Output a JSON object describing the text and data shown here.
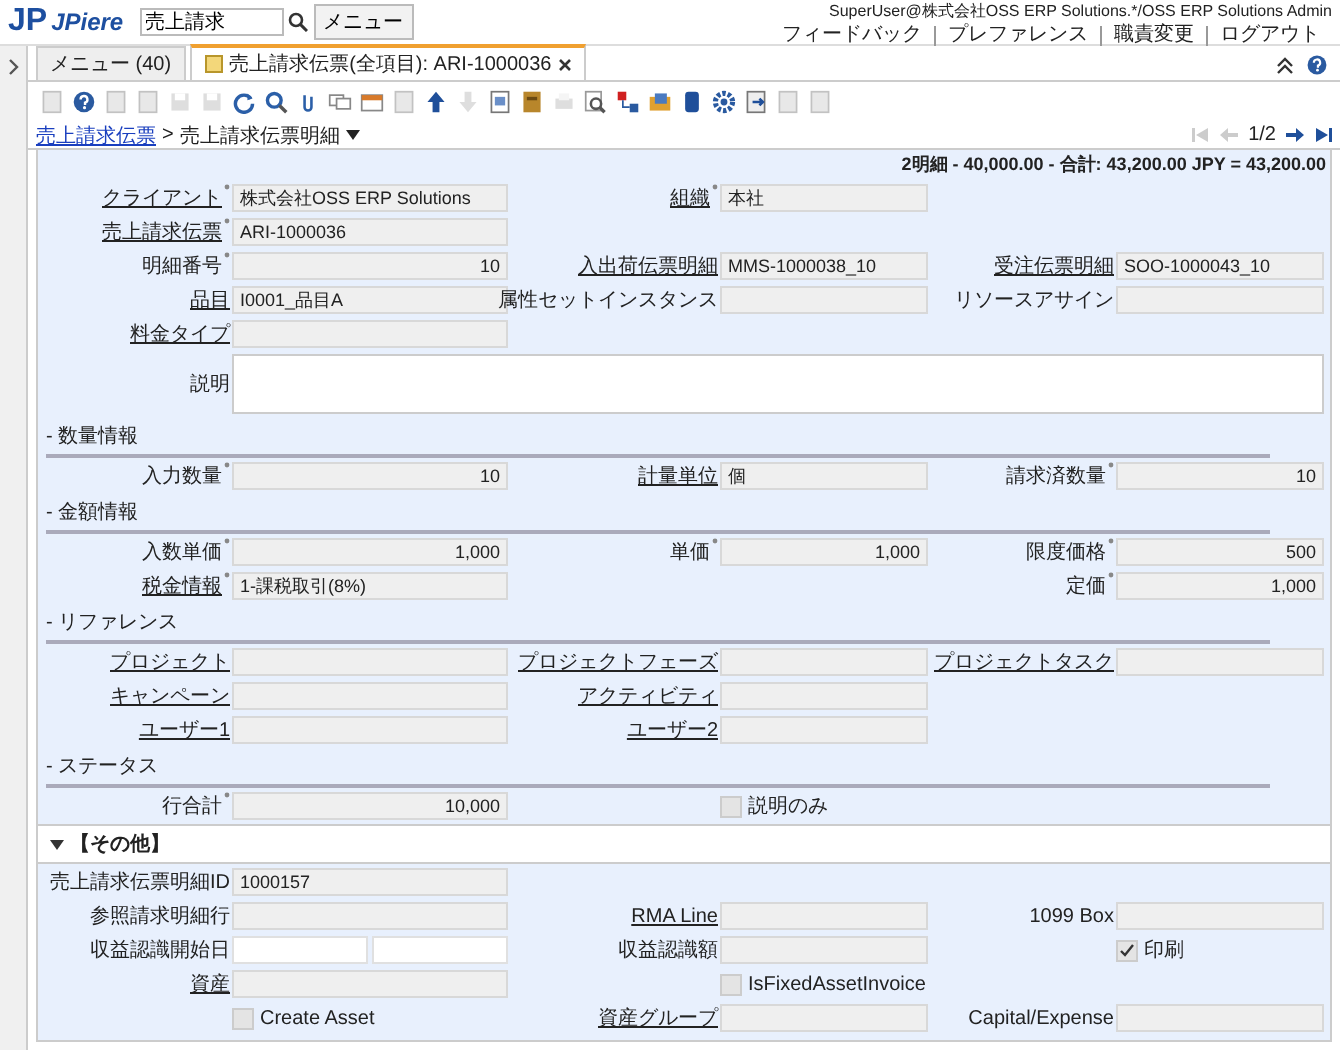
{
  "header": {
    "logo_mark": "JP",
    "logo_name": "JPiere",
    "search": {
      "value": "売上請求"
    },
    "menu_button": "メニュー",
    "user": "SuperUser@株式会社OSS ERP Solutions.*/OSS ERP Solutions Admin",
    "links": [
      "フィードバック",
      "プレファレンス",
      "職責変更",
      "ログアウト"
    ]
  },
  "tabs": [
    {
      "label": "メニュー (40)",
      "selected": false,
      "closable": false
    },
    {
      "label": "売上請求伝票(全項目): ARI-1000036",
      "selected": true,
      "closable": true
    }
  ],
  "toolbar": [
    {
      "kind": "doc",
      "disabled": true
    },
    {
      "kind": "help",
      "disabled": false
    },
    {
      "kind": "doc",
      "disabled": true
    },
    {
      "kind": "doc",
      "disabled": true
    },
    {
      "kind": "save",
      "disabled": true
    },
    {
      "kind": "save",
      "disabled": true
    },
    {
      "kind": "refresh",
      "disabled": false
    },
    {
      "kind": "search",
      "disabled": false
    },
    {
      "kind": "clip",
      "disabled": false
    },
    {
      "kind": "chat",
      "disabled": false
    },
    {
      "kind": "window",
      "disabled": false
    },
    {
      "kind": "doc",
      "disabled": true
    },
    {
      "kind": "up",
      "disabled": false
    },
    {
      "kind": "down",
      "disabled": true
    },
    {
      "kind": "report",
      "disabled": false
    },
    {
      "kind": "box",
      "disabled": false
    },
    {
      "kind": "print",
      "disabled": true
    },
    {
      "kind": "zoom",
      "disabled": false
    },
    {
      "kind": "flag",
      "disabled": false
    },
    {
      "kind": "folder",
      "disabled": false
    },
    {
      "kind": "db",
      "disabled": false
    },
    {
      "kind": "gear",
      "disabled": false
    },
    {
      "kind": "export",
      "disabled": false
    },
    {
      "kind": "doc",
      "disabled": true
    },
    {
      "kind": "doc",
      "disabled": true
    }
  ],
  "breadcrumb": {
    "parent": "売上請求伝票",
    "separator": ">",
    "current": "売上請求伝票明細"
  },
  "record_nav": {
    "position": "1/2",
    "buttons": [
      {
        "kind": "first",
        "disabled": true
      },
      {
        "kind": "prev",
        "disabled": true
      },
      {
        "kind": "next",
        "disabled": false
      },
      {
        "kind": "last",
        "disabled": false
      }
    ]
  },
  "summary": "2明細 - 40,000.00 - 合計: 43,200.00 JPY = 43,200.00",
  "sections": [
    {
      "kind": "plain",
      "rows": [
        [
          {
            "label": "クライアント",
            "link": true,
            "required": true,
            "kind": "text",
            "value": "株式会社OSS ERP Solutions"
          },
          {
            "label": "組織",
            "link": true,
            "required": true,
            "kind": "text",
            "value": "本社"
          },
          null
        ],
        [
          {
            "label": "売上請求伝票",
            "link": true,
            "required": true,
            "kind": "text",
            "value": "ARI-1000036"
          },
          null,
          null
        ],
        [
          {
            "label": "明細番号",
            "link": false,
            "required": true,
            "kind": "number",
            "value": "10"
          },
          {
            "label": "入出荷伝票明細",
            "link": true,
            "required": false,
            "kind": "text",
            "value": "MMS-1000038_10"
          },
          {
            "label": "受注伝票明細",
            "link": true,
            "required": false,
            "kind": "text",
            "value": "SOO-1000043_10"
          }
        ],
        [
          {
            "label": "品目",
            "link": true,
            "required": false,
            "kind": "text",
            "value": "I0001_品目A"
          },
          {
            "label": "属性セットインスタンス",
            "link": false,
            "required": false,
            "kind": "text"
          },
          {
            "label": "リソースアサイン",
            "link": false,
            "required": false,
            "kind": "text"
          }
        ],
        [
          {
            "label": "料金タイプ",
            "link": true,
            "required": false,
            "kind": "text"
          },
          null,
          null
        ],
        [
          {
            "label": "説明",
            "link": false,
            "required": false,
            "kind": "textarea"
          }
        ]
      ]
    },
    {
      "kind": "group",
      "title": "- 数量情報",
      "rows": [
        [
          {
            "label": "入力数量",
            "link": false,
            "required": true,
            "kind": "number",
            "value": "10"
          },
          {
            "label": "計量単位",
            "link": true,
            "required": false,
            "kind": "text",
            "value": "個"
          },
          {
            "label": "請求済数量",
            "link": false,
            "required": true,
            "kind": "number",
            "value": "10"
          }
        ]
      ]
    },
    {
      "kind": "group",
      "title": "- 金額情報",
      "rows": [
        [
          {
            "label": "入数単価",
            "link": false,
            "required": true,
            "kind": "number",
            "value": "1,000"
          },
          {
            "label": "単価",
            "link": false,
            "required": true,
            "kind": "number",
            "value": "1,000"
          },
          {
            "label": "限度価格",
            "link": false,
            "required": true,
            "kind": "number",
            "value": "500"
          }
        ],
        [
          {
            "label": "税金情報",
            "link": true,
            "required": true,
            "kind": "text",
            "value": "1-課税取引(8%)"
          },
          null,
          {
            "label": "定価",
            "link": false,
            "required": true,
            "kind": "number",
            "value": "1,000"
          }
        ]
      ]
    },
    {
      "kind": "group",
      "title": "- リファレンス",
      "rows": [
        [
          {
            "label": "プロジェクト",
            "link": true,
            "required": false,
            "kind": "text"
          },
          {
            "label": "プロジェクトフェーズ",
            "link": true,
            "required": false,
            "kind": "text"
          },
          {
            "label": "プロジェクトタスク",
            "link": true,
            "required": false,
            "kind": "text"
          }
        ],
        [
          {
            "label": "キャンペーン",
            "link": true,
            "required": false,
            "kind": "text"
          },
          {
            "label": "アクティビティ",
            "link": true,
            "required": false,
            "kind": "text"
          },
          null
        ],
        [
          {
            "label": "ユーザー1",
            "link": true,
            "required": false,
            "kind": "text"
          },
          {
            "label": "ユーザー2",
            "link": true,
            "required": false,
            "kind": "text"
          },
          null
        ]
      ]
    },
    {
      "kind": "group",
      "title": "- ステータス",
      "rows": [
        [
          {
            "label": "行合計",
            "link": false,
            "required": true,
            "kind": "number",
            "value": "10,000"
          },
          {
            "label": "説明のみ",
            "kind": "checkbox",
            "checked": false
          },
          null
        ]
      ]
    },
    {
      "kind": "panel",
      "title": "【その他】",
      "expanded": true,
      "rows": [
        [
          {
            "label": "売上請求伝票明細ID",
            "link": false,
            "required": false,
            "kind": "text",
            "value": "1000157"
          },
          null,
          null
        ],
        [
          {
            "label": "参照請求明細行",
            "link": false,
            "required": false,
            "kind": "text"
          },
          {
            "label": "RMA Line",
            "link": true,
            "required": false,
            "kind": "text"
          },
          {
            "label": "1099 Box",
            "link": false,
            "required": false,
            "kind": "text"
          }
        ],
        [
          {
            "label": "収益認識開始日",
            "link": false,
            "required": false,
            "kind": "date"
          },
          {
            "label": "収益認識額",
            "link": false,
            "required": false,
            "kind": "text"
          },
          {
            "label": "印刷",
            "kind": "checkbox",
            "checked": true
          }
        ],
        [
          {
            "label": "資産",
            "link": true,
            "required": false,
            "kind": "text"
          },
          {
            "label": "IsFixedAssetInvoice",
            "kind": "checkbox",
            "checked": false
          },
          null
        ],
        [
          {
            "label": "Create Asset",
            "kind": "checkbox",
            "checked": false
          },
          {
            "label": "資産グループ",
            "link": true,
            "required": false,
            "kind": "text"
          },
          {
            "label": "Capital/Expense",
            "link": false,
            "required": false,
            "kind": "text"
          }
        ]
      ]
    }
  ]
}
